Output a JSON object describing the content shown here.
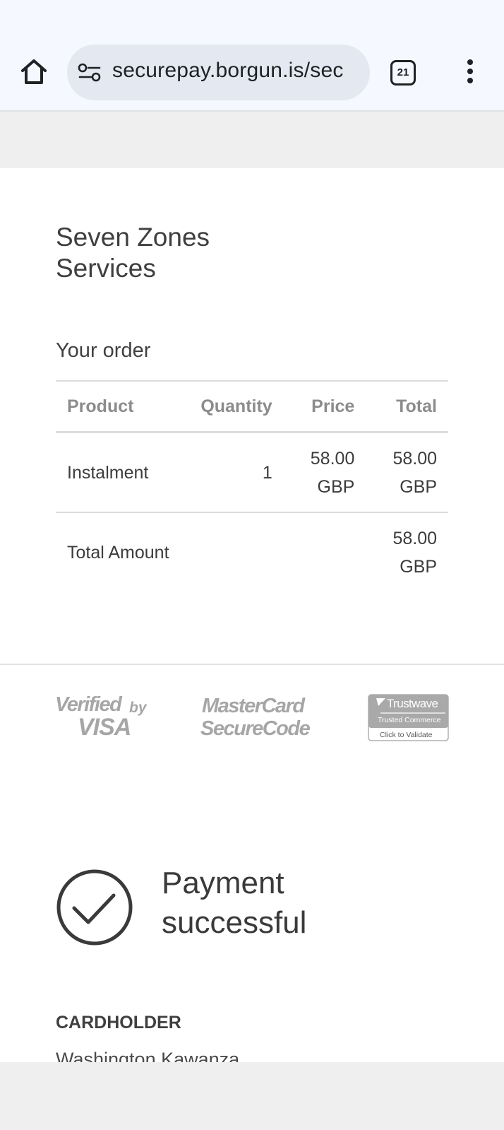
{
  "browser": {
    "url": "securepay.borgun.is/sec",
    "tab_count": "21"
  },
  "merchant": {
    "name": "Seven Zones Services"
  },
  "order": {
    "heading": "Your order",
    "columns": [
      "Product",
      "Quantity",
      "Price",
      "Total"
    ],
    "items": [
      {
        "product": "Instalment",
        "quantity": "1",
        "price": "58.00 GBP",
        "total": "58.00 GBP"
      }
    ],
    "total_label": "Total Amount",
    "total_value": "58.00 GBP"
  },
  "badges": {
    "visa_line1": "Verified",
    "visa_by": "by",
    "visa_line2": "VISA",
    "mastercard_line1": "MasterCard",
    "mastercard_line2": "SecureCode",
    "trustwave_name": "Trustwave",
    "trustwave_sub": "Trusted Commerce",
    "trustwave_action": "Click to Validate"
  },
  "status": {
    "message": "Payment successful",
    "icon": "check-circle-icon"
  },
  "cardholder": {
    "label": "CARDHOLDER",
    "name": "Washington Kawanza"
  },
  "colors": {
    "chrome_bg": "#f5f8fe",
    "omnibox_bg": "#e3e8f1",
    "page_bg": "#ffffff",
    "outer_bg": "#efefef",
    "badge_gray": "#a6a6a6"
  }
}
